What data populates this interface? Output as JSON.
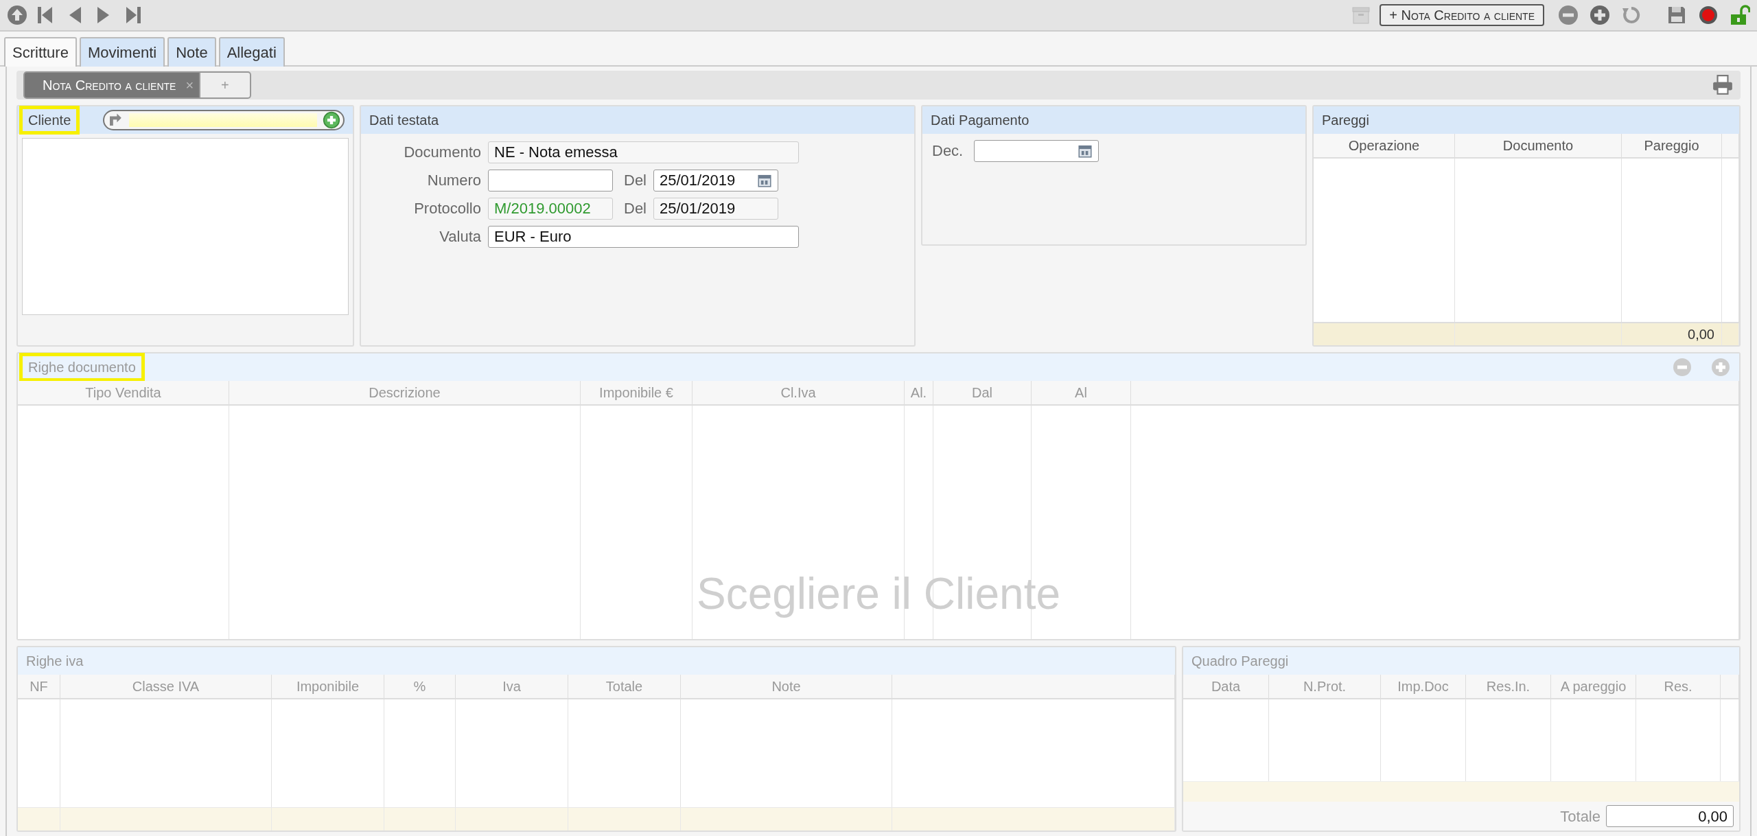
{
  "toolbar": {
    "action_button": "+ Nota Credito a cliente"
  },
  "tabs": [
    {
      "label": "Scritture",
      "selected": true
    },
    {
      "label": "Movimenti",
      "selected": false
    },
    {
      "label": "Note",
      "selected": false
    },
    {
      "label": "Allegati",
      "selected": false
    }
  ],
  "document_tabs": [
    {
      "label": "Nota Credito a cliente",
      "selected": true,
      "close": "×"
    },
    {
      "label": "+",
      "selected": false
    }
  ],
  "cliente": {
    "title": "Cliente",
    "highlighted": true
  },
  "dati_testata": {
    "title": "Dati testata",
    "rows": [
      {
        "fields": [
          {
            "label": "Documento",
            "value": "NE - Nota emessa",
            "kind": "text",
            "editable": false
          }
        ]
      },
      {
        "fields": [
          {
            "label": "Numero",
            "kind": "text",
            "editable": true
          },
          {
            "label": "Del",
            "value": "25/01/2019",
            "kind": "date",
            "editable": true
          }
        ]
      },
      {
        "fields": [
          {
            "label": "Protocollo",
            "value": "M/2019.00002",
            "kind": "text",
            "editable": false,
            "color": "#2f9a2f"
          },
          {
            "label": "Del",
            "value": "25/01/2019",
            "kind": "text",
            "editable": false
          }
        ]
      },
      {
        "fields": [
          {
            "label": "Valuta",
            "value": "EUR - Euro",
            "kind": "text",
            "editable": true
          }
        ]
      }
    ]
  },
  "dati_pagamento": {
    "title": "Dati Pagamento",
    "fields": [
      {
        "label": "Dec.",
        "kind": "date",
        "editable": true
      }
    ]
  },
  "pareggi": {
    "title": "Pareggi",
    "columns": [
      "Operazione",
      "Documento",
      "Pareggio"
    ],
    "total": "0,00"
  },
  "righe_documento": {
    "title": "Righe documento",
    "highlighted": true,
    "columns": [
      "Tipo Vendita",
      "Descrizione",
      "Imponibile €",
      "Cl.Iva",
      "Al.",
      "Dal",
      "Al"
    ],
    "empty_message": "Scegliere il Cliente"
  },
  "righe_iva": {
    "title": "Righe iva",
    "columns": [
      "NF",
      "Classe IVA",
      "Imponibile",
      "%",
      "Iva",
      "Totale",
      "Note"
    ]
  },
  "quadro_pareggi": {
    "title": "Quadro Pareggi",
    "columns": [
      "Data",
      "N.Prot.",
      "Imp.Doc",
      "Res.In.",
      "A pareggio",
      "Res."
    ],
    "total_label": "Totale",
    "total": "0,00"
  }
}
